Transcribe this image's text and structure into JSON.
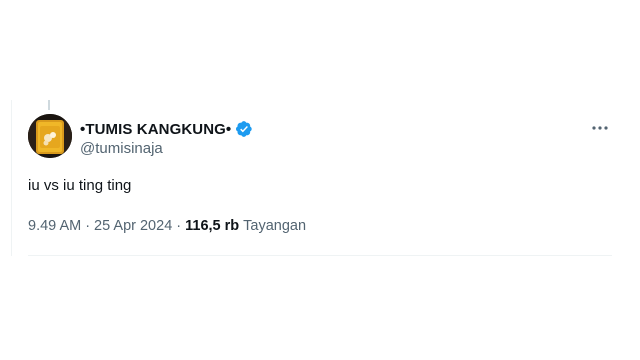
{
  "tweet": {
    "author": {
      "display_name": "•TUMIS KANGKUNG•",
      "handle": "@tumisinaja",
      "verified": true,
      "verified_icon": "verified-badge-icon",
      "badge_color": "#1d9bf0"
    },
    "text": "iu vs iu ting ting",
    "meta": {
      "time": "9.49 AM",
      "separator": "·",
      "date": "25 Apr 2024",
      "views_count": "116,5 rb",
      "views_label": "Tayangan"
    },
    "more_icon": "more-dots-icon"
  },
  "colors": {
    "text_primary": "#0f1419",
    "text_secondary": "#536471",
    "divider": "#eff3f4"
  }
}
